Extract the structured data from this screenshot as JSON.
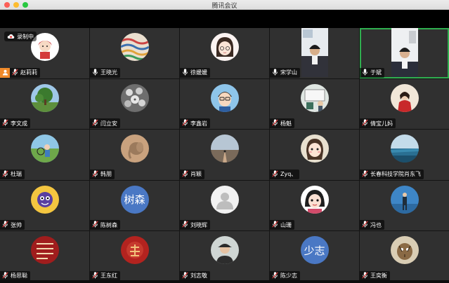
{
  "window": {
    "title": "腾讯会议"
  },
  "recording": {
    "label": "录制中"
  },
  "colors": {
    "active_border": "#2fae4f",
    "host_badge": "#f08a2a",
    "tile_bg": "#303030"
  },
  "participants": [
    {
      "name": "赵莉莉",
      "avatar": "cartoon-girl-red",
      "host": true
    },
    {
      "name": "王晓光",
      "avatar": "tapestry"
    },
    {
      "name": "徐媛媛",
      "avatar": "cartoon-girl-glasses"
    },
    {
      "name": "宋学山",
      "avatar": "video-man"
    },
    {
      "name": "于斌",
      "avatar": "video-man-2",
      "active": true
    },
    {
      "name": "李文成",
      "avatar": "tree"
    },
    {
      "name": "闫立安",
      "avatar": "flowers"
    },
    {
      "name": "李鑫岩",
      "avatar": "cartoon-boy-glasses"
    },
    {
      "name": "杨魁",
      "avatar": "classroom"
    },
    {
      "name": "倩宝儿妈",
      "avatar": "red-woman"
    },
    {
      "name": "杜瑞",
      "avatar": "child-field"
    },
    {
      "name": "韩朋",
      "avatar": "elephant"
    },
    {
      "name": "肖颖",
      "avatar": "road-sunset"
    },
    {
      "name": "Zyq、",
      "avatar": "cute-girl"
    },
    {
      "name": "长春科技学院肖东飞",
      "avatar": "sea"
    },
    {
      "name": "张帅",
      "avatar": "cartoon-yellow"
    },
    {
      "name": "陈树森",
      "avatar": "text",
      "avatar_text": "树森",
      "avatar_color": "#4a78c4"
    },
    {
      "name": "刘晓辉",
      "avatar": "default-person"
    },
    {
      "name": "山珊",
      "avatar": "cartoon-girl-black"
    },
    {
      "name": "冯也",
      "avatar": "lake-person"
    },
    {
      "name": "杨思聪",
      "avatar": "red-calligraphy",
      "avatar_text": "人好长远好 自强自来通 国家发中发"
    },
    {
      "name": "王东红",
      "avatar": "red-seal",
      "avatar_text": "王"
    },
    {
      "name": "刘志敬",
      "avatar": "man-cap"
    },
    {
      "name": "陈少志",
      "avatar": "text",
      "avatar_text": "少志",
      "avatar_color": "#4a78c4"
    },
    {
      "name": "王奕衡",
      "avatar": "tiger-art"
    }
  ]
}
